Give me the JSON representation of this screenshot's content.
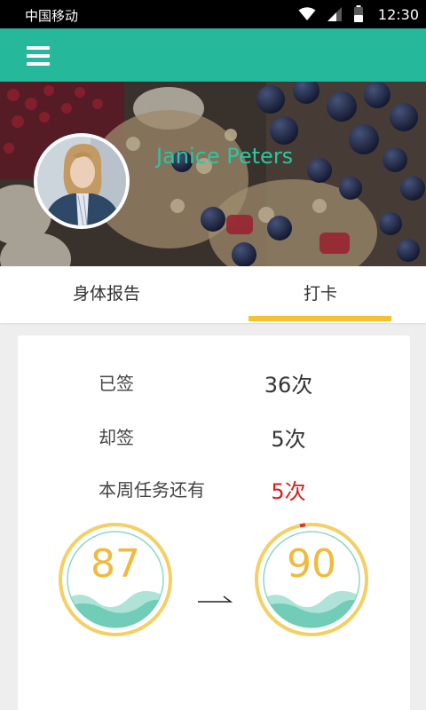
{
  "status_bar": {
    "carrier": "中国移动",
    "time": "12:30",
    "icons": [
      "wifi-icon",
      "signal-icon",
      "battery-icon"
    ]
  },
  "app_bar": {
    "color": "#26b89a",
    "menu_icon": "hamburger-menu-icon"
  },
  "profile": {
    "name": "Janice Peters"
  },
  "tabs": [
    {
      "label": "身体报告",
      "active": false
    },
    {
      "label": "打卡",
      "active": true
    }
  ],
  "colors": {
    "accent": "#26b89a",
    "tab_indicator": "#f6c02f",
    "warning": "#d81e1e",
    "gauge": "#f2b93a"
  },
  "checkin": {
    "rows": [
      {
        "label": "已签",
        "value": "36次"
      },
      {
        "label": "却签",
        "value": "5次"
      },
      {
        "label": "本周任务还有",
        "value": "5次"
      }
    ],
    "gauges": [
      {
        "value": "87"
      },
      {
        "value": "90"
      }
    ]
  }
}
